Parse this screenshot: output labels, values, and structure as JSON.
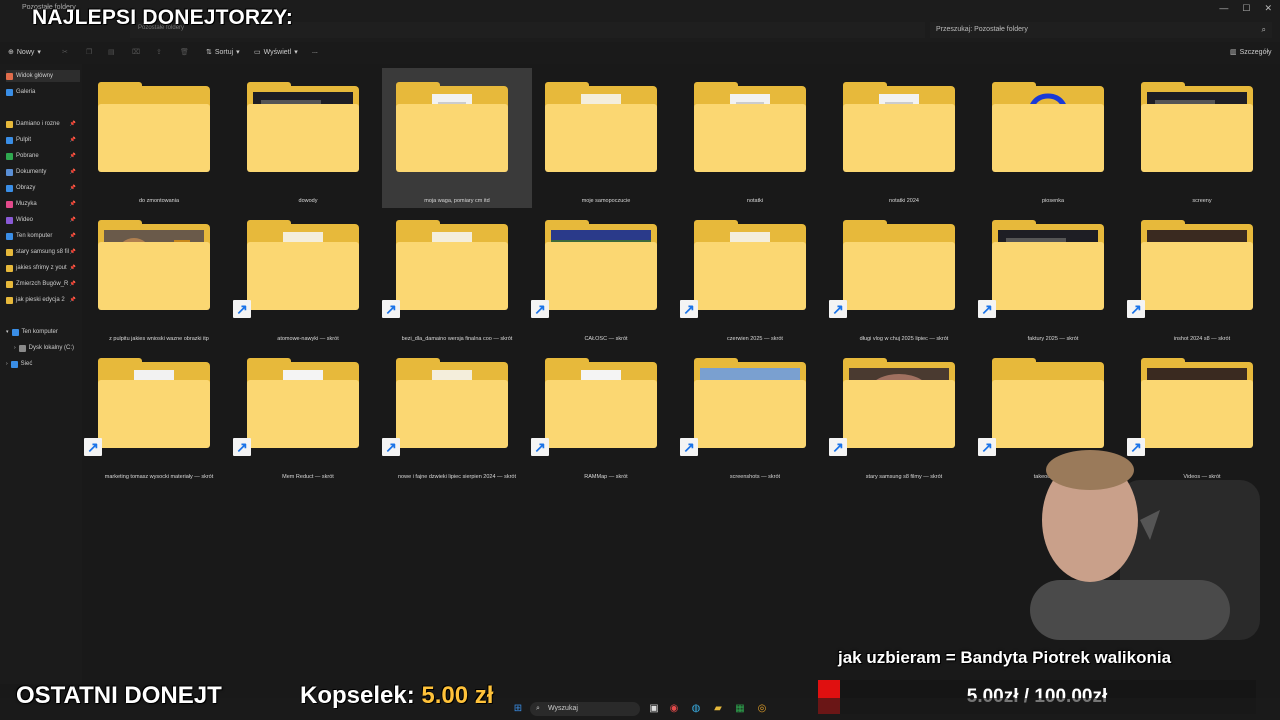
{
  "window": {
    "title": "Pozostałe foldery",
    "breadcrumb": "Pozostałe foldery"
  },
  "overlay": {
    "top_title": "NAJLEPSI DONEJTORZY:",
    "last_donation_label": "OSTATNI DONEJT",
    "last_donor_name": "Kopselek:",
    "last_donor_amount": "5.00 zł",
    "goal_text": "jak uzbieram = Bandyta Piotrek walikonia",
    "goal_progress_text": "5.00zł / 100.00zł",
    "goal_progress_fraction": 0.05,
    "goal_color": "#e01010"
  },
  "search": {
    "placeholder": "Przeszukaj: Pozostałe foldery"
  },
  "toolbar": {
    "new_label": "Nowy",
    "sort_label": "Sortuj",
    "view_label": "Wyświetl",
    "more_label": "...",
    "details_label": "Szczegóły"
  },
  "sidebar": {
    "items": [
      {
        "label": "Widok główny",
        "icon": "home-icon",
        "color": "#e06c4b"
      },
      {
        "label": "Galeria",
        "icon": "gallery-icon",
        "color": "#3a8ee6"
      },
      {
        "label": "Damiano i rozne",
        "icon": "folder-icon",
        "color": "#e7b93b"
      },
      {
        "label": "Pulpit",
        "icon": "desktop-icon",
        "color": "#3a8ee6"
      },
      {
        "label": "Pobrane",
        "icon": "download-icon",
        "color": "#2fa84f"
      },
      {
        "label": "Dokumenty",
        "icon": "documents-icon",
        "color": "#5a8fd6"
      },
      {
        "label": "Obrazy",
        "icon": "pictures-icon",
        "color": "#3a8ee6"
      },
      {
        "label": "Muzyka",
        "icon": "music-icon",
        "color": "#e24a8b"
      },
      {
        "label": "Wideo",
        "icon": "video-icon",
        "color": "#8a5ad6"
      },
      {
        "label": "Ten komputer",
        "icon": "computer-icon",
        "color": "#3a8ee6"
      },
      {
        "label": "stary samsung s8 fil",
        "icon": "folder-icon",
        "color": "#e7b93b"
      },
      {
        "label": "jakies sfrimy z yout",
        "icon": "folder-icon",
        "color": "#e7b93b"
      },
      {
        "label": "Zmierzch Bugów_R",
        "icon": "folder-icon",
        "color": "#e7b93b"
      },
      {
        "label": "jak pieski edycja 2",
        "icon": "folder-icon",
        "color": "#e7b93b"
      },
      {
        "label": "Ten komputer",
        "icon": "computer-icon",
        "color": "#3a8ee6"
      },
      {
        "label": "Dysk lokalny (C:)",
        "icon": "drive-icon",
        "color": "#8a8a8a"
      },
      {
        "label": "Sieć",
        "icon": "network-icon",
        "color": "#3a8ee6"
      }
    ]
  },
  "folders": [
    {
      "label": "do zmontowania",
      "thumb": "empty",
      "shortcut": false
    },
    {
      "label": "dowody",
      "thumb": "dark-ui",
      "shortcut": false
    },
    {
      "label": "moja waga, pomiary cm itd",
      "thumb": "paper",
      "shortcut": false,
      "selected": true
    },
    {
      "label": "moje samopoczucie",
      "thumb": "record",
      "shortcut": false
    },
    {
      "label": "notatki",
      "thumb": "paper",
      "shortcut": false
    },
    {
      "label": "notatki 2024",
      "thumb": "paper",
      "shortcut": false
    },
    {
      "label": "piosenka",
      "thumb": "headphones",
      "shortcut": false
    },
    {
      "label": "screeny",
      "thumb": "dark-ui",
      "shortcut": false
    },
    {
      "label": "z pulpitu jakies wnioski wazne obrazki itp",
      "thumb": "dog",
      "shortcut": false
    },
    {
      "label": "atomowe-nawyki — skrót",
      "thumb": "record",
      "shortcut": true
    },
    {
      "label": "bezi_dla_damaino wersja finalna coo — skrót",
      "thumb": "record",
      "shortcut": true
    },
    {
      "label": "CAŁOŚĆ — skrót",
      "thumb": "park",
      "shortcut": true
    },
    {
      "label": "czerwien 2025 — skrót",
      "thumb": "record",
      "shortcut": true
    },
    {
      "label": "długi vlog w chuj 2025 lipiec — skrót",
      "thumb": "empty",
      "shortcut": true
    },
    {
      "label": "faktury 2025 — skrót",
      "thumb": "dark-ui",
      "shortcut": true
    },
    {
      "label": "inshot 2024 s8 — skrót",
      "thumb": "photo-brown",
      "shortcut": true
    },
    {
      "label": "marketing tomasz wysocki materiały — skrót",
      "thumb": "paper-red",
      "shortcut": true
    },
    {
      "label": "Mem Reduct — skrót",
      "thumb": "sketch",
      "shortcut": true
    },
    {
      "label": "nowe i fajne dzwieki lipiec sierpien 2024 — skrót",
      "thumb": "record",
      "shortcut": true
    },
    {
      "label": "RAMMap — skrót",
      "thumb": "colors",
      "shortcut": true
    },
    {
      "label": "screenshots — skrót",
      "thumb": "landscape",
      "shortcut": true
    },
    {
      "label": "stary samsung s8 filmy — skrót",
      "thumb": "face",
      "shortcut": true
    },
    {
      "label": "takeout — skrót",
      "thumb": "empty",
      "shortcut": true
    },
    {
      "label": "Videos — skrót",
      "thumb": "photo-brown",
      "shortcut": true
    }
  ],
  "taskbar": {
    "search_label": "Wyszukaj"
  }
}
